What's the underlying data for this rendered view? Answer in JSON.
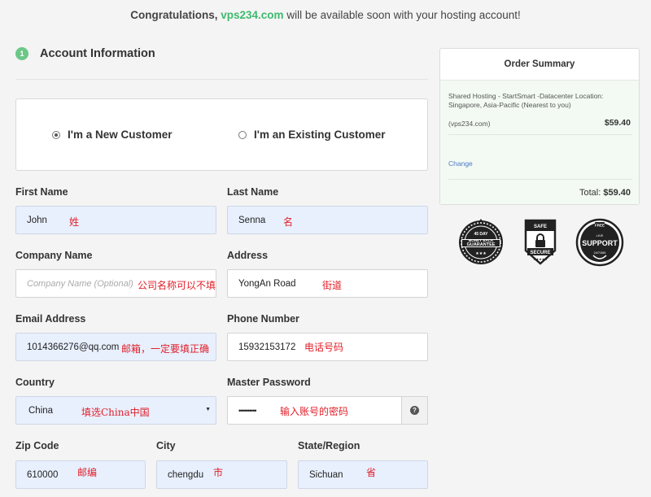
{
  "banner": {
    "prefix": "Congratulations,",
    "domain": "vps234.com",
    "suffix": "will be available soon with your hosting account!"
  },
  "section": {
    "step": "1",
    "title": "Account Information"
  },
  "customer_type": {
    "new": "I'm a New Customer",
    "existing": "I'm an Existing Customer",
    "selected": "new"
  },
  "form": {
    "first_name": {
      "label": "First Name",
      "value": "John",
      "note": "姓"
    },
    "last_name": {
      "label": "Last Name",
      "value": "Senna",
      "note": "名"
    },
    "company": {
      "label": "Company Name",
      "placeholder": "Company Name (Optional)",
      "note": "公司名称可以不填"
    },
    "address": {
      "label": "Address",
      "value": "YongAn Road",
      "note": "街道"
    },
    "email": {
      "label": "Email Address",
      "value": "1014366276@qq.com",
      "note": "邮箱，一定要填正确"
    },
    "phone": {
      "label": "Phone Number",
      "value": "15932153172",
      "note": "电话号码"
    },
    "country": {
      "label": "Country",
      "value": "China",
      "note": "填选China中国"
    },
    "password": {
      "label": "Master Password",
      "value": "••••••••••",
      "note": "输入账号的密码",
      "help": "?"
    },
    "zip": {
      "label": "Zip Code",
      "value": "610000",
      "note": "邮编"
    },
    "city": {
      "label": "City",
      "value": "chengdu",
      "note": "市"
    },
    "state": {
      "label": "State/Region",
      "value": "Sichuan",
      "note": "省"
    }
  },
  "summary": {
    "title": "Order Summary",
    "description": "Shared Hosting - StartSmart -Datacenter Location: Singapore, Asia-Pacific (Nearest to you)",
    "domain": "(vps234.com)",
    "price": "$59.40",
    "change": "Change",
    "total_label": "Total:",
    "total_value": "$59.40"
  },
  "badges": {
    "money_back": {
      "top": "45 DAY",
      "line1": "MONEY BACK",
      "line2": "GUARANTEE"
    },
    "secure": {
      "line1": "SAFE",
      "line2": "SECURE"
    },
    "support": {
      "top": "FREE",
      "middle": "LIVE",
      "main": "SUPPORT",
      "bottom": "24/7/365"
    }
  },
  "colors": {
    "accent_green": "#3dba6f",
    "badge_green": "#6cc788",
    "annotation_red": "#e0202a",
    "autofill_blue": "#e8f0fe",
    "link_blue": "#4a79c9"
  }
}
